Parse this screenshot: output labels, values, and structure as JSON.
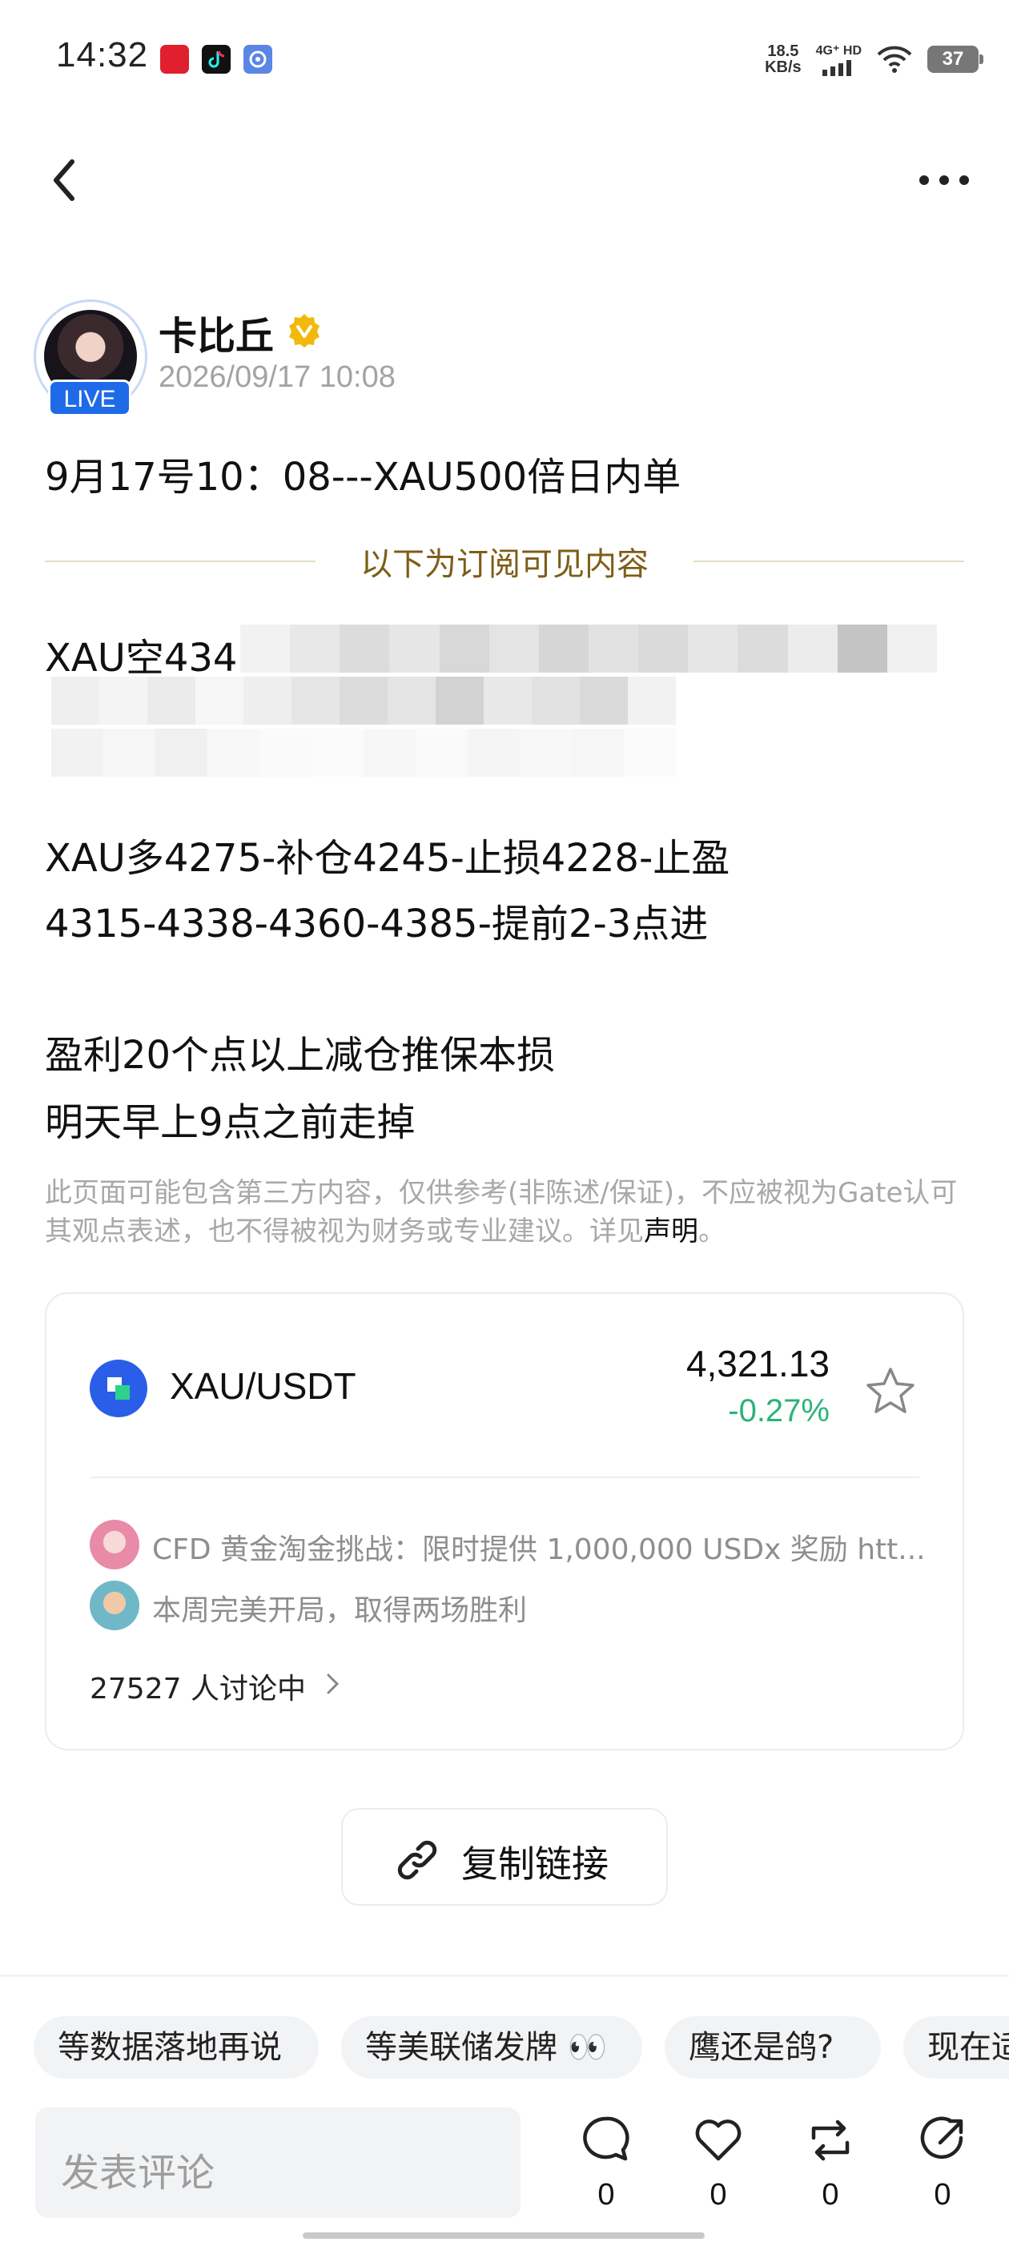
{
  "status_bar": {
    "time": "14:32",
    "net_speed_value": "18.5",
    "net_speed_unit": "KB/s",
    "network": "4G⁺ HD",
    "battery": "37"
  },
  "post": {
    "author": "卡比丘",
    "live_badge": "LIVE",
    "time": "2026/09/17 10:08",
    "title": "9月17号10：08---XAU500倍日内单",
    "subscriber_label": "以下为订阅可见内容",
    "blurred_line_prefix": "XAU空434",
    "lines": [
      "XAU多4275-补仓4245-止损4228-止盈",
      "4315-4338-4360-4385-提前2-3点进",
      "盈利20个点以上减仓推保本损",
      "明天早上9点之前走掉"
    ],
    "disclaimer_text": "此页面可能包含第三方内容，仅供参考(非陈述/保证)，不应被视为Gate认可其观点表述，也不得被视为财务或专业建议。详见",
    "disclaimer_link": "声明",
    "disclaimer_end": "。"
  },
  "market_card": {
    "pair": "XAU/USDT",
    "price": "4,321.13",
    "change": "-0.27%",
    "change_color": "#2bb37a",
    "discussions": [
      "CFD 黄金淘金挑战：限时提供 1,000,000 USDx 奖励 htt...",
      "本周完美开局，取得两场胜利"
    ],
    "discussing_count": "27527 人讨论中"
  },
  "copy_link_label": "复制链接",
  "tags": [
    "等数据落地再说",
    "等美联储发牌 👀",
    "鹰还是鸽?",
    "现在适"
  ],
  "bottom_bar": {
    "comment_placeholder": "发表评论",
    "comment_count": "0",
    "like_count": "0",
    "repost_count": "0",
    "share_count": "0"
  }
}
